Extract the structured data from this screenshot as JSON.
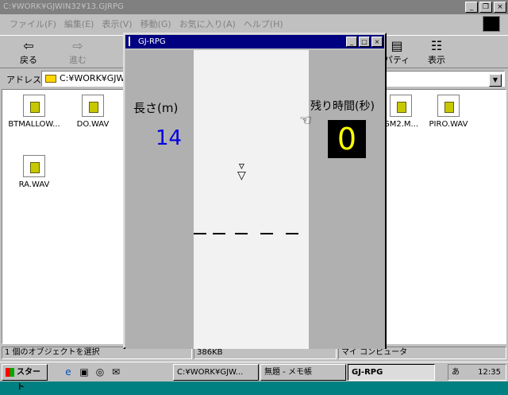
{
  "explorer": {
    "title": "C:¥WORK¥GJWIN32¥13.GJRPG",
    "menu": [
      "ファイル(F)",
      "編集(E)",
      "表示(V)",
      "移動(G)",
      "お気に入り(A)",
      "ヘルプ(H)"
    ],
    "toolbar": {
      "back": "戻る",
      "forward": "進む",
      "properties": "パティ",
      "view": "表示"
    },
    "address_label": "アドレス",
    "address_value": "C:¥WORK¥GJW",
    "files": [
      "BTMALLOW...",
      "DO.WAV",
      "GM2.M...",
      "PIRO.WAV",
      "RA.WAV"
    ],
    "status": {
      "selected": "1 個のオブジェクトを選択",
      "size": "386KB",
      "location": "マイ コンピュータ"
    }
  },
  "game": {
    "title": "GJ-RPG",
    "length_label": "長さ(m)",
    "length_value": "14",
    "time_label": "残り時間(秒)",
    "time_value": "0"
  },
  "taskbar": {
    "start": "スタート",
    "tasks": [
      "C:¥WORK¥GJW...",
      "無題 - メモ帳",
      "GJ-RPG"
    ],
    "clock": "12:35",
    "ime": "あ"
  }
}
